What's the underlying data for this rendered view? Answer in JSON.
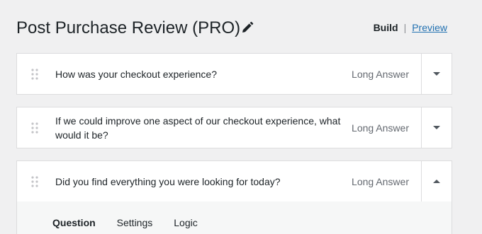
{
  "header": {
    "title": "Post Purchase Review (PRO)",
    "edit_icon": "pencil-icon",
    "mode_build": "Build",
    "mode_separator": "|",
    "mode_preview": "Preview"
  },
  "questions": [
    {
      "text": "How was your checkout experience?",
      "type": "Long Answer",
      "drag_icon": "drag-handle-icon",
      "toggle_icon": "chevron-down-icon",
      "expanded": false
    },
    {
      "text": "If we could improve one aspect of our checkout experience, what would it be?",
      "type": "Long Answer",
      "drag_icon": "drag-handle-icon",
      "toggle_icon": "chevron-down-icon",
      "expanded": false
    },
    {
      "text": "Did you find everything you were looking for today?",
      "type": "Long Answer",
      "drag_icon": "drag-handle-icon",
      "toggle_icon": "chevron-up-icon",
      "expanded": true
    }
  ],
  "expanded_tabs": [
    "Question",
    "Settings",
    "Logic"
  ],
  "active_tab": "Question",
  "colors": {
    "background": "#f0f0f1",
    "card": "#ffffff",
    "border": "#dcdcde",
    "link": "#2271b1",
    "muted_text": "#646970"
  }
}
